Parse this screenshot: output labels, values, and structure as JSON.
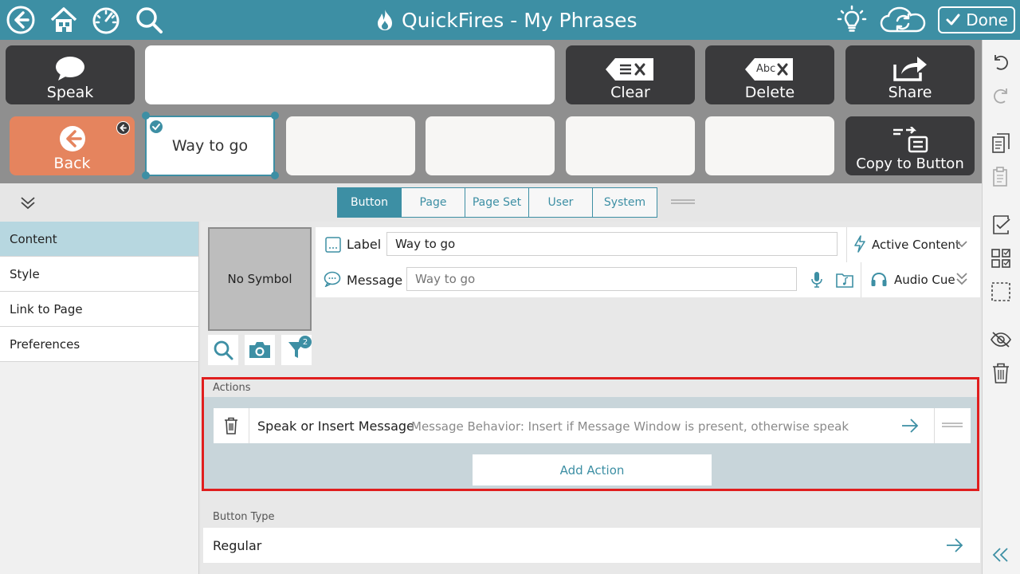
{
  "header": {
    "title": "QuickFires - My Phrases",
    "done_label": "Done",
    "accent_color": "#3d8fa4"
  },
  "message_bar": {
    "speak_label": "Speak",
    "clear_label": "Clear",
    "delete_label": "Delete",
    "share_label": "Share",
    "delete_icon_text": "Abc"
  },
  "phrase_bar": {
    "back_label": "Back",
    "selected_button_label": "Way to go",
    "copy_label": "Copy to Button"
  },
  "tabs": [
    {
      "label": "Button",
      "active": true
    },
    {
      "label": "Page",
      "active": false
    },
    {
      "label": "Page Set",
      "active": false
    },
    {
      "label": "User",
      "active": false
    },
    {
      "label": "System",
      "active": false
    }
  ],
  "side_nav": [
    {
      "label": "Content",
      "active": true
    },
    {
      "label": "Style",
      "active": false
    },
    {
      "label": "Link to Page",
      "active": false
    },
    {
      "label": "Preferences",
      "active": false
    }
  ],
  "symbol": {
    "placeholder": "No Symbol",
    "filter_count": "2"
  },
  "fields": {
    "label_title": "Label",
    "label_value": "Way to go",
    "message_title": "Message",
    "message_placeholder": "Way to go",
    "active_content_label": "Active Content",
    "audio_cue_label": "Audio Cue"
  },
  "actions": {
    "section_title": "Actions",
    "items": [
      {
        "name": "Speak or Insert Message",
        "description": "Message Behavior: Insert if Message Window is present, otherwise speak"
      }
    ],
    "add_label": "Add Action",
    "highlight_color": "#e01e1e"
  },
  "button_type": {
    "section_title": "Button Type",
    "value": "Regular"
  }
}
